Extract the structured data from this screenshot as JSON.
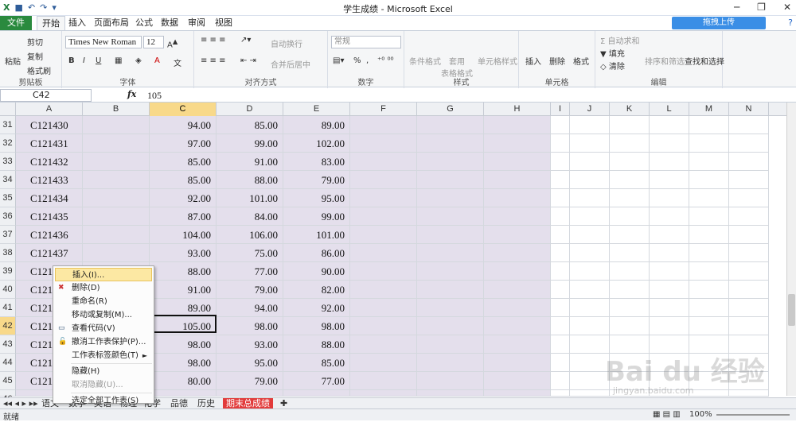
{
  "window": {
    "title": "学生成绩 - Microsoft Excel",
    "controls": [
      "─",
      "❐",
      "✕"
    ]
  },
  "tabs": [
    "文件",
    "开始",
    "插入",
    "页面布局",
    "公式",
    "数据",
    "审阅",
    "视图"
  ],
  "upload_button": "拖拽上传",
  "ribbon": {
    "clipboard": {
      "paste": "粘贴",
      "cut": "剪切",
      "copy": "复制",
      "format_painter": "格式刷",
      "label": "剪贴板"
    },
    "font": {
      "name": "Times New Roman",
      "size": "12",
      "label": "字体"
    },
    "alignment": {
      "wrap": "自动换行",
      "merge": "合并后居中",
      "label": "对齐方式"
    },
    "number": {
      "format": "常规",
      "label": "数字"
    },
    "styles": {
      "conditional": "条件格式",
      "table": "套用\n表格格式",
      "cell": "单元格样式",
      "label": "样式"
    },
    "cells": {
      "insert": "插入",
      "delete": "删除",
      "format": "格式",
      "label": "单元格"
    },
    "editing": {
      "autosum": "自动求和",
      "fill": "填充",
      "clear": "清除",
      "sort": "排序和筛选",
      "find": "查找和选择",
      "label": "编辑"
    }
  },
  "formula_bar": {
    "name_box": "C42",
    "fx": "fx",
    "value": "105"
  },
  "columns": [
    "A",
    "B",
    "C",
    "D",
    "E",
    "F",
    "G",
    "H",
    "I",
    "J",
    "K",
    "L",
    "M",
    "N"
  ],
  "rows": [
    {
      "num": "31",
      "id": "C121430",
      "c": "94.00",
      "d": "85.00",
      "e": "89.00"
    },
    {
      "num": "32",
      "id": "C121431",
      "c": "97.00",
      "d": "99.00",
      "e": "102.00"
    },
    {
      "num": "33",
      "id": "C121432",
      "c": "85.00",
      "d": "91.00",
      "e": "83.00"
    },
    {
      "num": "34",
      "id": "C121433",
      "c": "85.00",
      "d": "88.00",
      "e": "79.00"
    },
    {
      "num": "35",
      "id": "C121434",
      "c": "92.00",
      "d": "101.00",
      "e": "95.00"
    },
    {
      "num": "36",
      "id": "C121435",
      "c": "87.00",
      "d": "84.00",
      "e": "99.00"
    },
    {
      "num": "37",
      "id": "C121436",
      "c": "104.00",
      "d": "106.00",
      "e": "101.00"
    },
    {
      "num": "38",
      "id": "C121437",
      "c": "93.00",
      "d": "75.00",
      "e": "86.00"
    },
    {
      "num": "39",
      "id": "C121",
      "c": "88.00",
      "d": "77.00",
      "e": "90.00"
    },
    {
      "num": "40",
      "id": "C121",
      "c": "91.00",
      "d": "79.00",
      "e": "82.00"
    },
    {
      "num": "41",
      "id": "C121",
      "c": "89.00",
      "d": "94.00",
      "e": "92.00"
    },
    {
      "num": "42",
      "id": "C121",
      "c": "105.00",
      "d": "98.00",
      "e": "98.00"
    },
    {
      "num": "43",
      "id": "C121",
      "c": "98.00",
      "d": "93.00",
      "e": "88.00"
    },
    {
      "num": "44",
      "id": "C121",
      "c": "98.00",
      "d": "95.00",
      "e": "85.00"
    },
    {
      "num": "45",
      "id": "C121",
      "c": "80.00",
      "d": "79.00",
      "e": "77.00"
    },
    {
      "num": "46",
      "id": "",
      "c": "",
      "d": "",
      "e": ""
    }
  ],
  "context_menu": [
    {
      "label": "插入(I)...",
      "highlight": true
    },
    {
      "label": "删除(D)",
      "icon": "delete-sheet-icon"
    },
    {
      "label": "重命名(R)"
    },
    {
      "label": "移动或复制(M)..."
    },
    {
      "label": "查看代码(V)",
      "icon": "view-code-icon"
    },
    {
      "label": "撤消工作表保护(P)...",
      "icon": "unprotect-icon"
    },
    {
      "label": "工作表标签颜色(T)",
      "submenu": "►"
    },
    {
      "label": "隐藏(H)"
    },
    {
      "label": "取消隐藏(U)...",
      "disabled": true
    },
    {
      "label": "选定全部工作表(S)"
    }
  ],
  "sheet_tabs": [
    "语文",
    "数学",
    "英语",
    "物理",
    "化学",
    "品德",
    "历史",
    "期末总成绩"
  ],
  "status": {
    "ready": "就绪",
    "zoom": "100%"
  },
  "watermark": {
    "main": "Bai du 经验",
    "sub": "jingyan.baidu.com"
  }
}
